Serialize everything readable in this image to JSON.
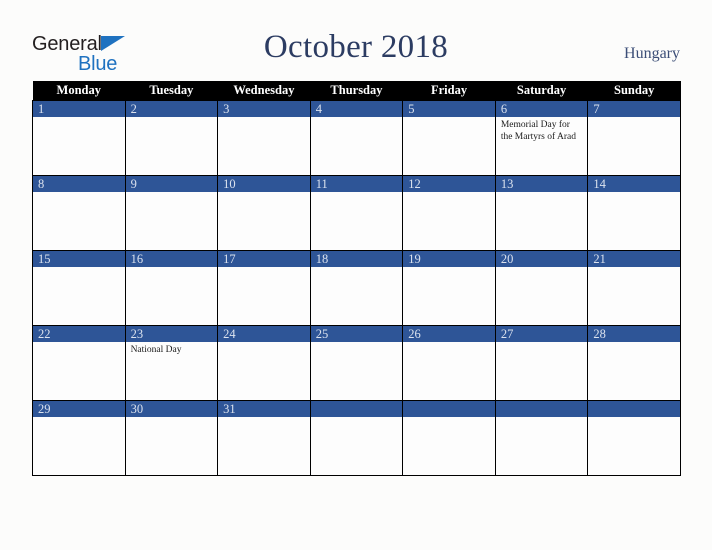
{
  "brand": {
    "name_part1": "General",
    "name_part2": "Blue",
    "triangle_icon": "blue-triangle-icon",
    "accent_color": "#1f72c0",
    "text_color": "#231f20"
  },
  "header": {
    "title": "October 2018",
    "country": "Hungary",
    "title_color": "#2c3c62"
  },
  "calendar": {
    "month": "October",
    "year": "2018",
    "week_start": "Monday",
    "header_bg": "#000000",
    "daynum_bg": "#2e5597",
    "weekdays": [
      "Monday",
      "Tuesday",
      "Wednesday",
      "Thursday",
      "Friday",
      "Saturday",
      "Sunday"
    ],
    "weeks": [
      [
        {
          "day": "1",
          "events": []
        },
        {
          "day": "2",
          "events": []
        },
        {
          "day": "3",
          "events": []
        },
        {
          "day": "4",
          "events": []
        },
        {
          "day": "5",
          "events": []
        },
        {
          "day": "6",
          "events": [
            "Memorial Day for the Martyrs of Arad"
          ]
        },
        {
          "day": "7",
          "events": []
        }
      ],
      [
        {
          "day": "8",
          "events": []
        },
        {
          "day": "9",
          "events": []
        },
        {
          "day": "10",
          "events": []
        },
        {
          "day": "11",
          "events": []
        },
        {
          "day": "12",
          "events": []
        },
        {
          "day": "13",
          "events": []
        },
        {
          "day": "14",
          "events": []
        }
      ],
      [
        {
          "day": "15",
          "events": []
        },
        {
          "day": "16",
          "events": []
        },
        {
          "day": "17",
          "events": []
        },
        {
          "day": "18",
          "events": []
        },
        {
          "day": "19",
          "events": []
        },
        {
          "day": "20",
          "events": []
        },
        {
          "day": "21",
          "events": []
        }
      ],
      [
        {
          "day": "22",
          "events": []
        },
        {
          "day": "23",
          "events": [
            "National Day"
          ]
        },
        {
          "day": "24",
          "events": []
        },
        {
          "day": "25",
          "events": []
        },
        {
          "day": "26",
          "events": []
        },
        {
          "day": "27",
          "events": []
        },
        {
          "day": "28",
          "events": []
        }
      ],
      [
        {
          "day": "29",
          "events": []
        },
        {
          "day": "30",
          "events": []
        },
        {
          "day": "31",
          "events": []
        },
        {
          "day": "",
          "events": []
        },
        {
          "day": "",
          "events": []
        },
        {
          "day": "",
          "events": []
        },
        {
          "day": "",
          "events": []
        }
      ]
    ]
  }
}
